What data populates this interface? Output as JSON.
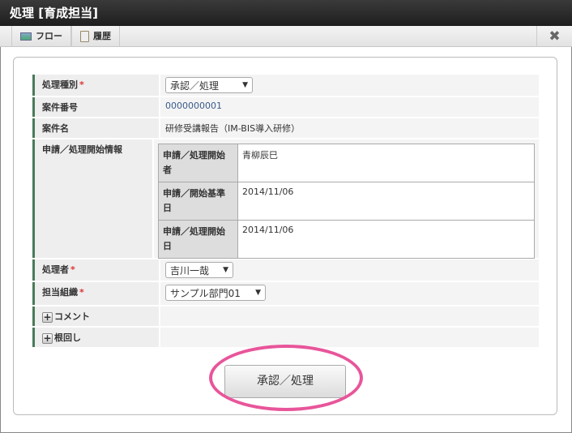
{
  "window": {
    "title": "処理 [育成担当]"
  },
  "toolbar": {
    "flow": "フロー",
    "history": "履歴",
    "close": "✖"
  },
  "form": {
    "process_type": {
      "label": "処理種別",
      "value": "承認／処理"
    },
    "matter_number": {
      "label": "案件番号",
      "value": "0000000001"
    },
    "matter_name": {
      "label": "案件名",
      "value": "研修受講報告（IM-BIS導入研修）"
    },
    "start_info": {
      "label": "申請／処理開始情報",
      "rows": [
        {
          "label": "申請／処理開始者",
          "value": "青柳辰巳"
        },
        {
          "label": "申請／開始基準日",
          "value": "2014/11/06"
        },
        {
          "label": "申請／処理開始日",
          "value": "2014/11/06"
        }
      ]
    },
    "processor": {
      "label": "処理者",
      "value": "吉川一哉"
    },
    "org": {
      "label": "担当組織",
      "value": "サンプル部門01"
    },
    "comment": {
      "label": "コメント"
    },
    "nemawashi": {
      "label": "根回し"
    },
    "required_mark": "*"
  },
  "submit": {
    "label": "承認／処理"
  },
  "colors": {
    "accent": "#4a7a5a",
    "highlight": "#e8559a"
  }
}
